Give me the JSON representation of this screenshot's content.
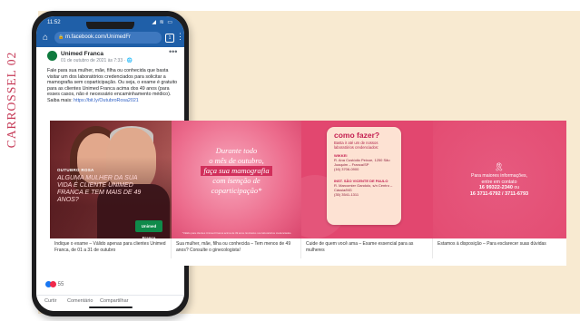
{
  "side_title": "CARROSSEL 02",
  "phone": {
    "status": {
      "time": "11:52",
      "icons": "◢ ≋ ▭"
    },
    "browser": {
      "url": "m.facebook.com/UnimedFr",
      "tab_count": "1"
    },
    "post": {
      "author": "Unimed Franca",
      "meta": "01 de outubro de 2021 às 7:33 · 🌐",
      "text": "Fale para sua mulher, mãe, filha ou conhecida que basta visitar um dos laboratórios credenciados para solicitar a mamografia sem coparticipação. Ou seja, o exame é gratuito para as clientes Unimed Franca acima dos 49 anos (para esses casos, não é necessário encaminhamento médico).",
      "link_prefix": "Saiba mais: ",
      "link": "https://bit.ly/OutubroRosa2021",
      "reactions_count": "55",
      "actions": {
        "like": "Curtir",
        "comment": "Comentário",
        "share": "Compartilhar"
      }
    }
  },
  "slides": [
    {
      "tag": "OUTUBRO ROSA",
      "headline": "ALGUMA MULHER DA SUA VIDA É CLIENTE UNIMED FRANCA E TEM MAIS DE 49 ANOS?",
      "logo": "Unimed Franca",
      "caption": "Indique o exame – Válido apenas para clientes Unimed Franca, de 01 a 31 de outubro"
    },
    {
      "script_line1": "Durante todo",
      "script_line2": "o mês de outubro,",
      "script_highlight": "faça sua mamografia",
      "script_line4": "com isenção de",
      "script_line5": "coparticipação*",
      "fine": "*Válido para clientes Unimed Franca acima de 49 anos. Exclusivo nos laboratórios credenciados.",
      "caption": "Sua mulher, mãe, filha ou conhecida – Tem menos de 49 anos? Consulte o ginecologista!"
    },
    {
      "heading": "como fazer?",
      "sub": "Basta ir até um de nossos laboratórios credenciados:",
      "lab1_name": "WIKKEI",
      "lab1_address": "R. Ana Custódio Peixoe, 1250 São Joaquim – Franca/SP",
      "lab1_phone": "(16) 3706-0900",
      "lab2_name": "INST. SÃO VICENTE DE PAULO",
      "lab2_address": "R. Marcomier Gandolo, s/n Centro – Cássia/MG",
      "lab2_phone": "(35) 3541-1311",
      "caption": "Cuide de quem você ama – Exame essencial para as mulheres"
    },
    {
      "line1": "Para maiores informações,",
      "line2": "entre em contato",
      "phone_main": "16 99322-2340",
      "phone_or": " ou",
      "phone_alt": "16 3711-6792 / 3711-6793",
      "caption": "Estamos à disposição – Para esclarecer suas dúvidas"
    }
  ],
  "colors": {
    "accent": "#c63a57",
    "facebook_blue": "#1f5fa8",
    "pink": "#e44e74",
    "beige": "#f8ead1"
  }
}
